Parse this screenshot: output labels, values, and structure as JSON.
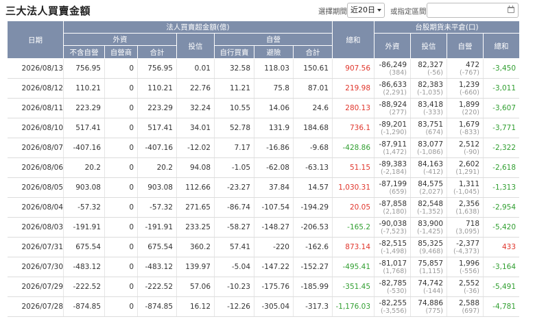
{
  "title": "三大法人買賣金額",
  "controls": {
    "period_label": "選擇期間",
    "period_value": "近20日",
    "range_label": "或指定區間",
    "date_value": ""
  },
  "header": {
    "date": "日期",
    "amount_group": "法人買賣超金額(億)",
    "foreign": "外資",
    "foreign_ex": "不含自營",
    "foreign_dealer": "自營商",
    "foreign_total": "合計",
    "trust": "投信",
    "dealer": "自營",
    "dealer_self": "自行買賣",
    "dealer_hedge": "避險",
    "dealer_total": "合計",
    "grand_total": "總和",
    "futures_group": "台股期貨未平倉(口)",
    "fut_foreign": "外資",
    "fut_trust": "投信",
    "fut_dealer": "自營",
    "fut_total": "總和"
  },
  "colors": {
    "positive": "#e0352b",
    "negative": "#2f9e2f",
    "header_bg": "#7e8eaa"
  },
  "rows": [
    {
      "date": "2026/08/13",
      "f_ex": "756.95",
      "f_dl": "0",
      "f_tot": "756.95",
      "trust": "0.01",
      "d_self": "32.58",
      "d_hedge": "118.03",
      "d_tot": "150.61",
      "total": "907.56",
      "fu_f": "-86,249",
      "fu_f_c": "(384)",
      "fu_t": "82,327",
      "fu_t_c": "(-56)",
      "fu_d": "472",
      "fu_d_c": "(-767)",
      "fu_tot": "-3,450"
    },
    {
      "date": "2026/08/12",
      "f_ex": "110.21",
      "f_dl": "0",
      "f_tot": "110.21",
      "trust": "22.76",
      "d_self": "11.21",
      "d_hedge": "75.8",
      "d_tot": "87.01",
      "total": "219.98",
      "fu_f": "-86,633",
      "fu_f_c": "(2,291)",
      "fu_t": "82,383",
      "fu_t_c": "(-1,035)",
      "fu_d": "1,239",
      "fu_d_c": "(-660)",
      "fu_tot": "-3,011"
    },
    {
      "date": "2026/08/11",
      "f_ex": "223.29",
      "f_dl": "0",
      "f_tot": "223.29",
      "trust": "32.24",
      "d_self": "10.55",
      "d_hedge": "14.06",
      "d_tot": "24.6",
      "total": "280.13",
      "fu_f": "-88,924",
      "fu_f_c": "(277)",
      "fu_t": "83,418",
      "fu_t_c": "(-333)",
      "fu_d": "1,899",
      "fu_d_c": "(220)",
      "fu_tot": "-3,607"
    },
    {
      "date": "2026/08/10",
      "f_ex": "517.41",
      "f_dl": "0",
      "f_tot": "517.41",
      "trust": "34.01",
      "d_self": "52.78",
      "d_hedge": "131.9",
      "d_tot": "184.68",
      "total": "736.1",
      "fu_f": "-89,201",
      "fu_f_c": "(-1,290)",
      "fu_t": "83,751",
      "fu_t_c": "(674)",
      "fu_d": "1,679",
      "fu_d_c": "(-833)",
      "fu_tot": "-3,771"
    },
    {
      "date": "2026/08/07",
      "f_ex": "-407.16",
      "f_dl": "0",
      "f_tot": "-407.16",
      "trust": "-12.02",
      "d_self": "7.17",
      "d_hedge": "-16.86",
      "d_tot": "-9.68",
      "total": "-428.86",
      "fu_f": "-87,911",
      "fu_f_c": "(1,472)",
      "fu_t": "83,077",
      "fu_t_c": "(-1,086)",
      "fu_d": "2,512",
      "fu_d_c": "(-90)",
      "fu_tot": "-2,322"
    },
    {
      "date": "2026/08/06",
      "f_ex": "20.2",
      "f_dl": "0",
      "f_tot": "20.2",
      "trust": "94.08",
      "d_self": "-1.05",
      "d_hedge": "-62.08",
      "d_tot": "-63.13",
      "total": "51.15",
      "fu_f": "-89,383",
      "fu_f_c": "(-2,184)",
      "fu_t": "84,163",
      "fu_t_c": "(-412)",
      "fu_d": "2,602",
      "fu_d_c": "(1,291)",
      "fu_tot": "-2,618"
    },
    {
      "date": "2026/08/05",
      "f_ex": "903.08",
      "f_dl": "0",
      "f_tot": "903.08",
      "trust": "112.66",
      "d_self": "-23.27",
      "d_hedge": "37.84",
      "d_tot": "14.57",
      "total": "1,030.31",
      "fu_f": "-87,199",
      "fu_f_c": "(659)",
      "fu_t": "84,575",
      "fu_t_c": "(2,027)",
      "fu_d": "1,311",
      "fu_d_c": "(-1,045)",
      "fu_tot": "-1,313"
    },
    {
      "date": "2026/08/04",
      "f_ex": "-57.32",
      "f_dl": "0",
      "f_tot": "-57.32",
      "trust": "271.65",
      "d_self": "-86.74",
      "d_hedge": "-107.54",
      "d_tot": "-194.29",
      "total": "20.05",
      "fu_f": "-87,858",
      "fu_f_c": "(2,180)",
      "fu_t": "82,548",
      "fu_t_c": "(-1,352)",
      "fu_d": "2,356",
      "fu_d_c": "(1,638)",
      "fu_tot": "-2,954"
    },
    {
      "date": "2026/08/03",
      "f_ex": "-191.91",
      "f_dl": "0",
      "f_tot": "-191.91",
      "trust": "233.25",
      "d_self": "-58.27",
      "d_hedge": "-148.27",
      "d_tot": "-206.53",
      "total": "-165.2",
      "fu_f": "-90,038",
      "fu_f_c": "(-7,523)",
      "fu_t": "83,900",
      "fu_t_c": "(-1,425)",
      "fu_d": "718",
      "fu_d_c": "(3,095)",
      "fu_tot": "-5,420"
    },
    {
      "date": "2026/07/31",
      "f_ex": "675.54",
      "f_dl": "0",
      "f_tot": "675.54",
      "trust": "360.2",
      "d_self": "57.41",
      "d_hedge": "-220",
      "d_tot": "-162.6",
      "total": "873.14",
      "fu_f": "-82,515",
      "fu_f_c": "(-1,498)",
      "fu_t": "85,325",
      "fu_t_c": "(9,468)",
      "fu_d": "-2,377",
      "fu_d_c": "(-4,373)",
      "fu_tot": "433"
    },
    {
      "date": "2026/07/30",
      "f_ex": "-483.12",
      "f_dl": "0",
      "f_tot": "-483.12",
      "trust": "139.97",
      "d_self": "-5.04",
      "d_hedge": "-147.22",
      "d_tot": "-152.27",
      "total": "-495.41",
      "fu_f": "-81,017",
      "fu_f_c": "(1,768)",
      "fu_t": "75,857",
      "fu_t_c": "(1,115)",
      "fu_d": "1,996",
      "fu_d_c": "(-556)",
      "fu_tot": "-3,164"
    },
    {
      "date": "2026/07/29",
      "f_ex": "-222.52",
      "f_dl": "0",
      "f_tot": "-222.52",
      "trust": "57.06",
      "d_self": "-10.23",
      "d_hedge": "-175.76",
      "d_tot": "-185.99",
      "total": "-351.45",
      "fu_f": "-82,785",
      "fu_f_c": "(-530)",
      "fu_t": "74,742",
      "fu_t_c": "(-144)",
      "fu_d": "2,552",
      "fu_d_c": "(-36)",
      "fu_tot": "-5,491"
    },
    {
      "date": "2026/07/28",
      "f_ex": "-874.85",
      "f_dl": "0",
      "f_tot": "-874.85",
      "trust": "16.12",
      "d_self": "-12.26",
      "d_hedge": "-305.04",
      "d_tot": "-317.3",
      "total": "-1,176.03",
      "fu_f": "-82,255",
      "fu_f_c": "(-3,556)",
      "fu_t": "74,886",
      "fu_t_c": "(775)",
      "fu_d": "2,588",
      "fu_d_c": "(697)",
      "fu_tot": "-4,781"
    }
  ]
}
